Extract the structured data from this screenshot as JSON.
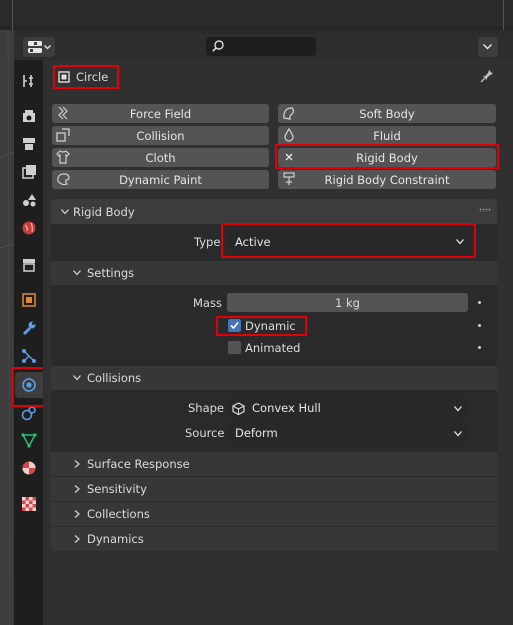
{
  "object": {
    "name": "Circle"
  },
  "physics_buttons": [
    {
      "label": "Force Field",
      "icon": "force-field-icon"
    },
    {
      "label": "Soft Body",
      "icon": "soft-body-icon"
    },
    {
      "label": "Collision",
      "icon": "collision-icon"
    },
    {
      "label": "Fluid",
      "icon": "fluid-icon"
    },
    {
      "label": "Cloth",
      "icon": "cloth-icon"
    },
    {
      "label": "Rigid Body",
      "icon": "close-icon"
    },
    {
      "label": "Dynamic Paint",
      "icon": "dynamic-paint-icon"
    },
    {
      "label": "Rigid Body Constraint",
      "icon": "rigid-body-constraint-icon"
    }
  ],
  "rigid_body": {
    "header": "Rigid Body",
    "type_label": "Type",
    "type_value": "Active",
    "settings": {
      "header": "Settings",
      "mass_label": "Mass",
      "mass_value": "1 kg",
      "dynamic_label": "Dynamic",
      "dynamic_checked": true,
      "animated_label": "Animated",
      "animated_checked": false
    },
    "collisions": {
      "header": "Collisions",
      "shape_label": "Shape",
      "shape_value": "Convex Hull",
      "source_label": "Source",
      "source_value": "Deform"
    },
    "subpanels": [
      "Surface Response",
      "Sensitivity",
      "Collections",
      "Dynamics"
    ]
  },
  "tabs": [
    "tool",
    "render",
    "output",
    "view-layer",
    "scene",
    "world",
    "collection",
    "object",
    "modifiers",
    "particles",
    "physics",
    "constraints",
    "data",
    "material",
    "texture"
  ],
  "colors": {
    "highlight": "#e0000a",
    "accent": "#4772b3",
    "active_tab": "#3d3d3d"
  }
}
